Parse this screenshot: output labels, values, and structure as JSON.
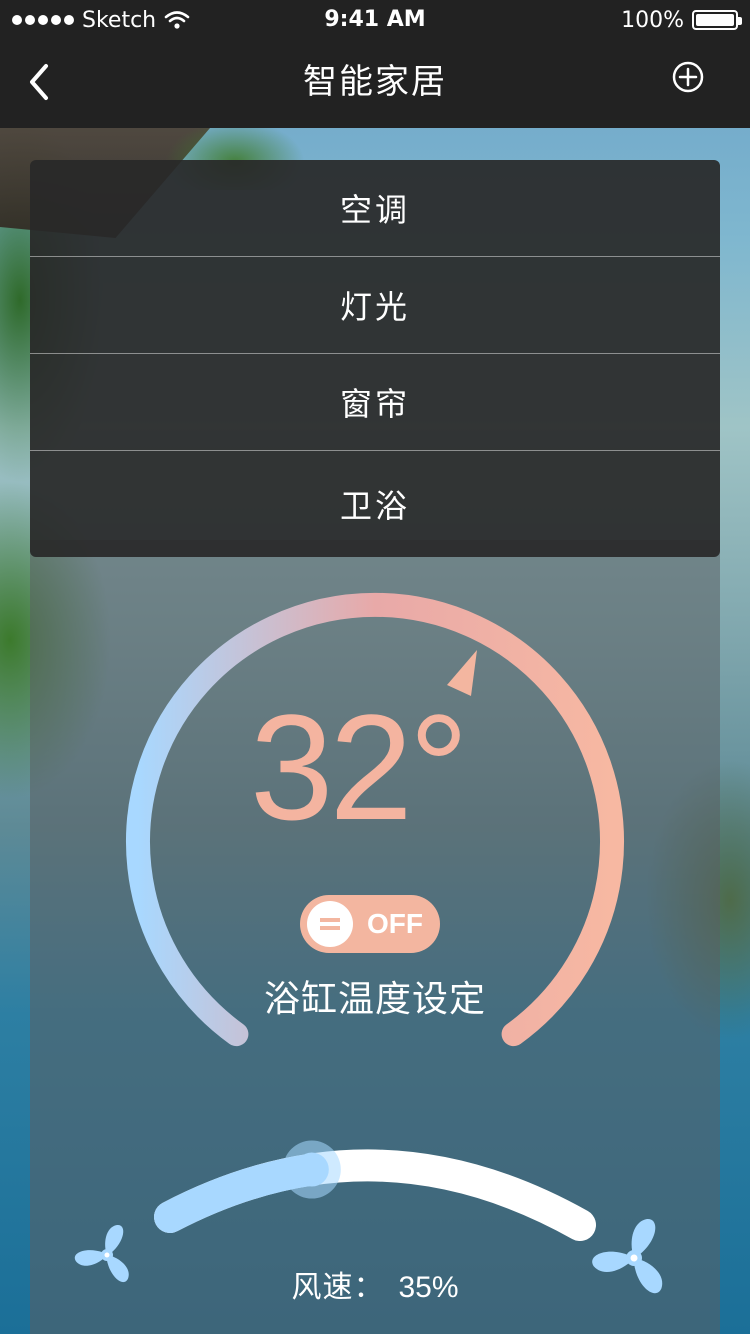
{
  "status_bar": {
    "carrier": "Sketch",
    "time": "9:41 AM",
    "battery": "100%"
  },
  "nav": {
    "title": "智能家居",
    "back_icon": "chevron-left-icon",
    "add_icon": "plus-circle-icon"
  },
  "menu": {
    "items": [
      {
        "label": "空调"
      },
      {
        "label": "灯光"
      },
      {
        "label": "窗帘"
      },
      {
        "label": "卫浴"
      }
    ]
  },
  "thermostat": {
    "temperature": "32°",
    "toggle_label": "OFF",
    "caption": "浴缸温度设定"
  },
  "fan": {
    "label": "风速：",
    "value": "35%",
    "level": 0.35
  },
  "colors": {
    "cool": "#a8d8ff",
    "warm": "#f7b8a2",
    "accent": "#f3b6a0"
  }
}
